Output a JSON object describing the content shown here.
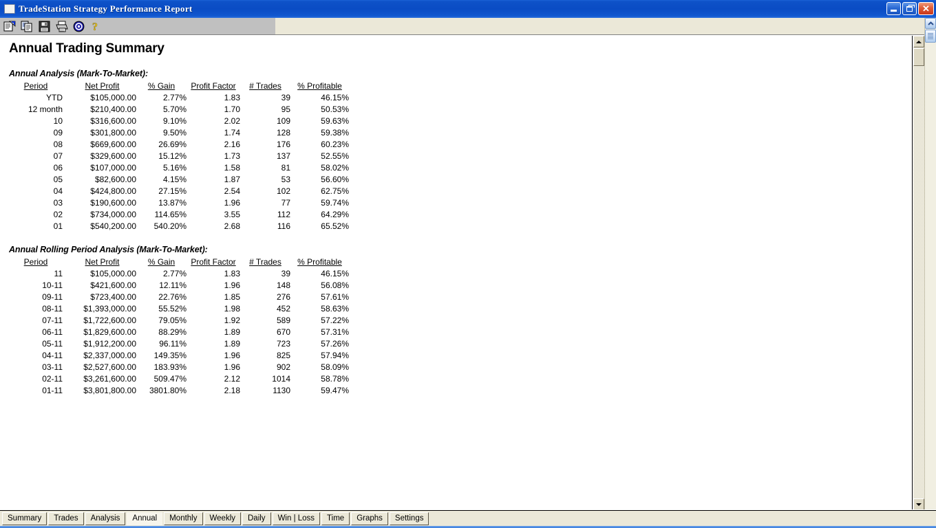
{
  "window": {
    "title": "TradeStation Strategy Performance Report",
    "icon": "window-document-icon",
    "minimize_label": "Minimize",
    "restore_label": "Restore",
    "close_label": "Close",
    "titlebar_color": "#0a4cc4",
    "toolbar_color": "#c0c0c0",
    "body_color": "#ebe8d8"
  },
  "toolbar": {
    "buttons": [
      {
        "name": "open-report-icon",
        "label": "Open"
      },
      {
        "name": "copy-icon",
        "label": "Copy"
      },
      {
        "name": "save-icon",
        "label": "Save"
      },
      {
        "name": "print-icon",
        "label": "Print"
      },
      {
        "name": "target-icon",
        "label": "Properties"
      },
      {
        "name": "help-icon",
        "label": "Help"
      }
    ]
  },
  "report": {
    "title": "Annual Trading Summary",
    "sections": [
      {
        "heading": "Annual Analysis (Mark-To-Market):",
        "columns": [
          "Period",
          "Net Profit",
          "% Gain",
          "Profit Factor",
          "# Trades",
          "% Profitable"
        ],
        "rows": [
          [
            "YTD",
            "$105,000.00",
            "2.77%",
            "1.83",
            "39",
            "46.15%"
          ],
          [
            "12 month",
            "$210,400.00",
            "5.70%",
            "1.70",
            "95",
            "50.53%"
          ],
          [
            "10",
            "$316,600.00",
            "9.10%",
            "2.02",
            "109",
            "59.63%"
          ],
          [
            "09",
            "$301,800.00",
            "9.50%",
            "1.74",
            "128",
            "59.38%"
          ],
          [
            "08",
            "$669,600.00",
            "26.69%",
            "2.16",
            "176",
            "60.23%"
          ],
          [
            "07",
            "$329,600.00",
            "15.12%",
            "1.73",
            "137",
            "52.55%"
          ],
          [
            "06",
            "$107,000.00",
            "5.16%",
            "1.58",
            "81",
            "58.02%"
          ],
          [
            "05",
            "$82,600.00",
            "4.15%",
            "1.87",
            "53",
            "56.60%"
          ],
          [
            "04",
            "$424,800.00",
            "27.15%",
            "2.54",
            "102",
            "62.75%"
          ],
          [
            "03",
            "$190,600.00",
            "13.87%",
            "1.96",
            "77",
            "59.74%"
          ],
          [
            "02",
            "$734,000.00",
            "114.65%",
            "3.55",
            "112",
            "64.29%"
          ],
          [
            "01",
            "$540,200.00",
            "540.20%",
            "2.68",
            "116",
            "65.52%"
          ]
        ]
      },
      {
        "heading": "Annual Rolling Period Analysis (Mark-To-Market):",
        "columns": [
          "Period",
          "Net Profit",
          "% Gain",
          "Profit Factor",
          "# Trades",
          "% Profitable"
        ],
        "rows": [
          [
            "11",
            "$105,000.00",
            "2.77%",
            "1.83",
            "39",
            "46.15%"
          ],
          [
            "10-11",
            "$421,600.00",
            "12.11%",
            "1.96",
            "148",
            "56.08%"
          ],
          [
            "09-11",
            "$723,400.00",
            "22.76%",
            "1.85",
            "276",
            "57.61%"
          ],
          [
            "08-11",
            "$1,393,000.00",
            "55.52%",
            "1.98",
            "452",
            "58.63%"
          ],
          [
            "07-11",
            "$1,722,600.00",
            "79.05%",
            "1.92",
            "589",
            "57.22%"
          ],
          [
            "06-11",
            "$1,829,600.00",
            "88.29%",
            "1.89",
            "670",
            "57.31%"
          ],
          [
            "05-11",
            "$1,912,200.00",
            "96.11%",
            "1.89",
            "723",
            "57.26%"
          ],
          [
            "04-11",
            "$2,337,000.00",
            "149.35%",
            "1.96",
            "825",
            "57.94%"
          ],
          [
            "03-11",
            "$2,527,600.00",
            "183.93%",
            "1.96",
            "902",
            "58.09%"
          ],
          [
            "02-11",
            "$3,261,600.00",
            "509.47%",
            "2.12",
            "1014",
            "58.78%"
          ],
          [
            "01-11",
            "$3,801,800.00",
            "3801.80%",
            "2.18",
            "1130",
            "59.47%"
          ]
        ]
      }
    ]
  },
  "tabs": {
    "active": "Annual",
    "items": [
      {
        "label": "Summary"
      },
      {
        "label": "Trades"
      },
      {
        "label": "Analysis"
      },
      {
        "label": "Annual"
      },
      {
        "label": "Monthly"
      },
      {
        "label": "Weekly"
      },
      {
        "label": "Daily"
      },
      {
        "label": "Win | Loss"
      },
      {
        "label": "Time"
      },
      {
        "label": "Graphs"
      },
      {
        "label": "Settings"
      }
    ]
  },
  "scrollbars": {
    "document": {
      "up_label": "Scroll up",
      "down_label": "Scroll down",
      "thumb_label": "Scroll thumb"
    },
    "window": {
      "up_label": "Scroll up",
      "down_label": "Scroll down",
      "thumb_label": "Scroll thumb"
    }
  }
}
